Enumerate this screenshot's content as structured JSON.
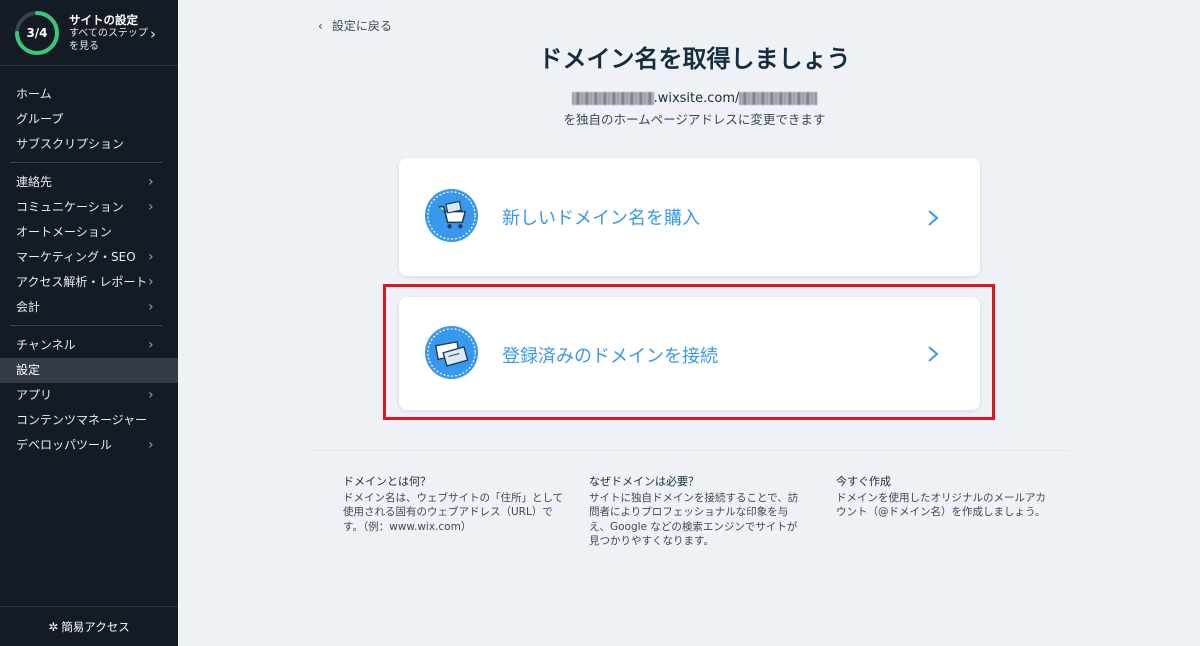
{
  "sidebar": {
    "setup": {
      "progress": "3/4",
      "progress_fraction": 0.75,
      "title": "サイトの設定",
      "subtitle": "すべてのステップを見る"
    },
    "items": [
      {
        "label": "ホーム"
      },
      {
        "label": "グループ"
      },
      {
        "label": "サブスクリプション"
      },
      {
        "label": "連絡先"
      },
      {
        "label": "コミュニケーション"
      },
      {
        "label": "オートメーション"
      },
      {
        "label": "マーケティング・SEO"
      },
      {
        "label": "アクセス解析・レポート"
      },
      {
        "label": "会計"
      },
      {
        "label": "チャンネル"
      },
      {
        "label": "設定"
      },
      {
        "label": "アプリ"
      },
      {
        "label": "コンテンツマネージャー"
      },
      {
        "label": "デベロッパツール"
      }
    ],
    "active_item": "設定",
    "quick_access": "簡易アクセス"
  },
  "main": {
    "back_label": "設定に戻る",
    "title": "ドメイン名を取得しましょう",
    "url_domain": ".wixsite.com/",
    "url_description": "を独自のホームページアドレスに変更できます",
    "options": [
      {
        "label": "新しいドメイン名を購入",
        "icon": "shopping-cart-icon"
      },
      {
        "label": "登録済みのドメインを接続",
        "icon": "domain-cards-icon"
      }
    ],
    "info": [
      {
        "heading": "ドメインとは何？",
        "body": "ドメイン名は、ウェブサイトの「住所」として使用される固有のウェブアドレス（URL）です。（例：www.wix.com）"
      },
      {
        "heading": "なぜドメインは必要？",
        "body": "サイトに独自ドメインを接続することで、訪問者によりプロフェッショナルな印象を与え、Google などの検索エンジンでサイトが見つかりやすくなります。"
      },
      {
        "heading": "今すぐ作成",
        "body": "ドメインを使用したオリジナルのメールアカウント（@ドメイン名）を作成しましょう。"
      }
    ]
  },
  "colors": {
    "sidebar_bg": "#141b24",
    "page_bg": "#eef1f6",
    "accent_blue": "#3899ec",
    "progress_green": "#37c87c",
    "highlight_red": "#e0141e"
  }
}
